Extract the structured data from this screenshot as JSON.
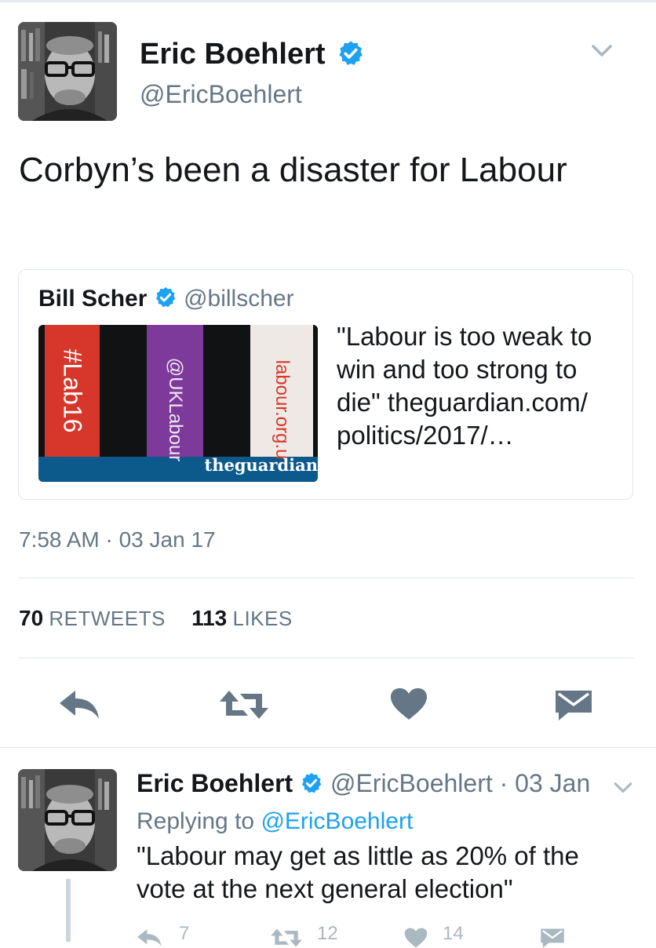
{
  "main_tweet": {
    "author_name": "Eric Boehlert",
    "author_handle": "@EricBoehlert",
    "text": "Corbyn’s been a disaster for Labour",
    "timestamp": "7:58 AM · 03 Jan 17",
    "retweets_count": "70",
    "retweets_label": "RETWEETS",
    "likes_count": "113",
    "likes_label": "LIKES"
  },
  "quoted_tweet": {
    "author_name": "Bill Scher",
    "author_handle": "@billscher",
    "text": "\"Labour is too weak to win and too strong to die\" theguardian.com/ politics/2017/…",
    "image": {
      "banner_left": "#Lab16",
      "banner_middle": "@UKLabour",
      "banner_right": "labour.org.u",
      "watermark": "theguardian"
    }
  },
  "reply_tweet": {
    "author_name": "Eric Boehlert",
    "author_handle_date": "@EricBoehlert · 03 Jan",
    "replying_prefix": "Replying to",
    "replying_handle": "@EricBoehlert",
    "text": "\"Labour may get as little as 20% of the vote at the next general election\"",
    "reply_count": "7",
    "retweet_count": "12",
    "like_count": "14"
  },
  "icons": [
    "verified-badge-icon",
    "chevron-down-icon",
    "reply-icon",
    "retweet-icon",
    "heart-icon",
    "message-icon"
  ],
  "colors": {
    "accent": "#1da1f2",
    "muted": "#657786",
    "icon": "#657786",
    "border": "#e1e8ed"
  }
}
